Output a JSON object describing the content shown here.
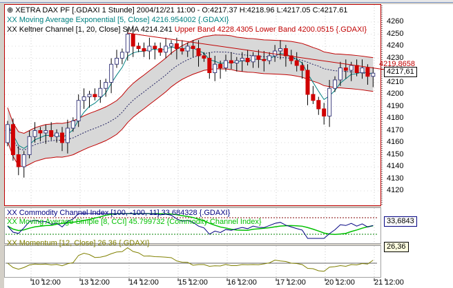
{
  "legend": {
    "main_title": "XETRA DAX PF [.GDAXI  1 Stunde] 2004/12/21 11:00 - O:4217.37 H:4218.96 L:4217.05 C:4217.61",
    "ema": "XX Moving Average Exponential [5, Close] 4216.954002 {.GDAXI}",
    "keltner_prefix": "XX Keltner Channel [1, 20, Close] SMA 4214.241",
    "keltner_bands": "Upper Band 4228.4305 Lower Band 4200.0515 {.GDAXI}",
    "cci": "XX Commodity Channel Index [100, -100, 11] 33.684328 {.GDAXI}",
    "cci_ma": "XX Moving Average Simple [8, CCI] 45.799732 {Commodity Channel Index}",
    "momentum": "XX Momentum [12, Close] 26.36 {.GDAXI}"
  },
  "trendline_label": "4219.8658",
  "current_price": "4217,61",
  "cci_value": "33,6843",
  "momentum_value": "26,36",
  "colors": {
    "up": "#ffffff",
    "down": "#d00000",
    "outline": "#404080",
    "band": "#c00000",
    "fill": "#d8d8d8",
    "ema": "#008080",
    "cci": "#000080",
    "cci_ma": "#00c000",
    "momentum": "#808000"
  },
  "chart_data": {
    "type": "candlestick",
    "y_ticks": [
      4260,
      4250,
      4240,
      4230,
      4220,
      4210,
      4200,
      4190,
      4180,
      4170,
      4160,
      4150,
      4140,
      4130,
      4120
    ],
    "ylim": [
      4113,
      4267
    ],
    "x_labels": [
      "10 12:00",
      "13 12:00",
      "14 12:00",
      "15 12:00",
      "16 12:00",
      "17 12:00",
      "20 12:00",
      "21 12:00"
    ],
    "keltner_offset": 14,
    "closes": [
      4175,
      4150,
      4140,
      4150,
      4165,
      4170,
      4168,
      4170,
      4165,
      4168,
      4160,
      4172,
      4178,
      4195,
      4198,
      4200,
      4198,
      4205,
      4210,
      4225,
      4230,
      4235,
      4250,
      4240,
      4238,
      4236,
      4240,
      4238,
      4235,
      4240,
      4242,
      4238,
      4236,
      4240,
      4238,
      4232,
      4230,
      4218,
      4225,
      4222,
      4228,
      4226,
      4228,
      4230,
      4227,
      4232,
      4229,
      4228,
      4232,
      4236,
      4238,
      4232,
      4228,
      4224,
      4220,
      4200,
      4195,
      4188,
      4182,
      4205,
      4212,
      4222,
      4220,
      4224,
      4218,
      4222,
      4215,
      4217.61
    ],
    "first_open": 4160
  }
}
